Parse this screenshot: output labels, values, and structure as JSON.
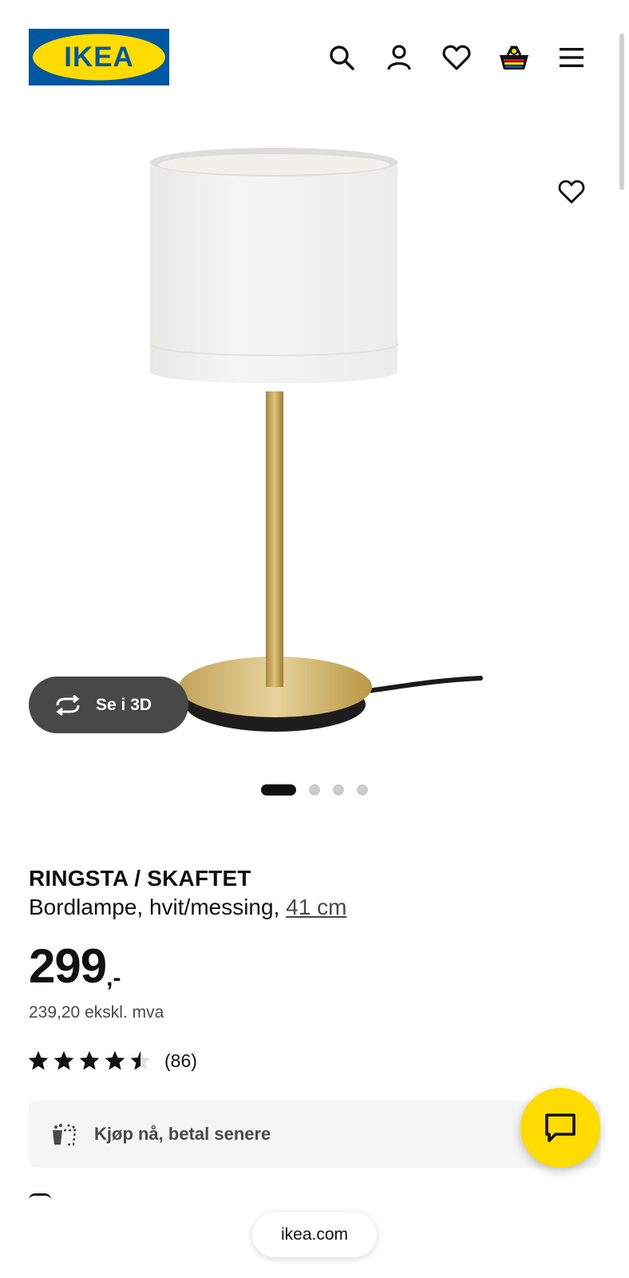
{
  "header": {
    "logo_text": "IKEA",
    "icons": [
      "search-icon",
      "user-icon",
      "heart-icon",
      "basket-icon",
      "menu-icon"
    ]
  },
  "gallery": {
    "view_3d_label": "Se i 3D",
    "image_count": 4,
    "active_image": 1
  },
  "product": {
    "name": "RINGSTA / SKAFTET",
    "description": "Bordlampe, hvit/messing,",
    "size": "41 cm",
    "price_integer": "299",
    "price_decimal": ",-",
    "price_ex_vat": "239,20 ekskl. mva",
    "rating_value": 4.5,
    "rating_max": 5,
    "review_count": "(86)"
  },
  "klarna": {
    "label": "Kjøp nå, betal senere"
  },
  "browser": {
    "url": "ikea.com"
  },
  "colors": {
    "ikea_blue": "#0058a3",
    "ikea_yellow": "#ffdb00",
    "brass": "#c9a85c",
    "dark_button": "#484848"
  }
}
